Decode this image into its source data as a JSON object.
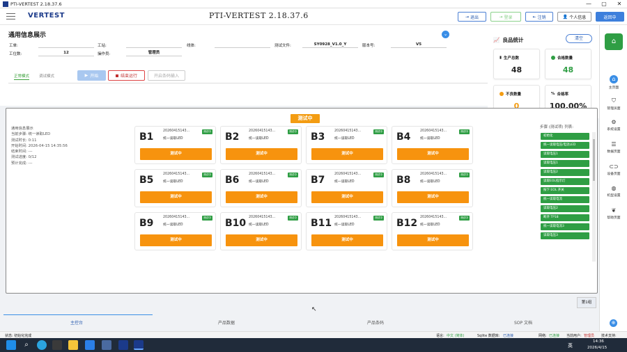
{
  "window": {
    "title": "PTI-VERTEST 2.18.37.6",
    "controls": [
      "—",
      "▢",
      "✕"
    ]
  },
  "header": {
    "logo": "VERTEST",
    "title": "PTI-VERTEST  2.18.37.6",
    "buttons": {
      "exit": "退出",
      "login": "登录",
      "logout": "注销",
      "profile": "个人信息",
      "back": "返回中"
    }
  },
  "page": {
    "title": "通用信息展示"
  },
  "form": {
    "row1": [
      {
        "label": "工单:",
        "value": ""
      },
      {
        "label": "工站:",
        "value": ""
      },
      {
        "label": "线体:",
        "value": ""
      },
      {
        "label": "测试文件:",
        "value": "SY0928_V1.0_Y"
      },
      {
        "label": "版本号:",
        "value": "V5"
      }
    ],
    "row2": [
      {
        "label": "工位数:",
        "value": "12"
      },
      {
        "label": "操作员:",
        "value": "管理员"
      }
    ]
  },
  "modes": {
    "normal": "正常模式",
    "debug": "调试模式"
  },
  "controls": {
    "start": "开始",
    "stop": "结束运行",
    "scan": "开启条码输入"
  },
  "stats": {
    "title": "良品统计",
    "clear": "清空",
    "cards": [
      {
        "label": "生产总数",
        "value": "48",
        "color": "#222222"
      },
      {
        "label": "合格数量",
        "value": "48",
        "color": "#2f9e44"
      },
      {
        "label": "不良数量",
        "value": "0",
        "color": "#f39c12"
      },
      {
        "label": "合格率",
        "value": "100.00%",
        "color": "#222222"
      }
    ]
  },
  "test": {
    "status": "测试中",
    "info": [
      "通用信息展示",
      "当前步骤:  统一读取LED",
      "测试时长:  0:11",
      "开始时间:  2026-04-15 14:35:56",
      "结束时间:  ---",
      "测试进度:  0/12",
      "预计完成:  ---"
    ],
    "units": [
      {
        "name": "B1",
        "sn": "20260415143...",
        "step": "统一读取LED",
        "badge": "测试中",
        "state": "测试中"
      },
      {
        "name": "B2",
        "sn": "20260415143...",
        "step": "统一读取LED",
        "badge": "测试中",
        "state": "测试中"
      },
      {
        "name": "B3",
        "sn": "20260415143...",
        "step": "统一读取LED",
        "badge": "测试中",
        "state": "测试中"
      },
      {
        "name": "B4",
        "sn": "20260415143...",
        "step": "统一读取LED",
        "badge": "测试中",
        "state": "测试中"
      },
      {
        "name": "B5",
        "sn": "20260415143...",
        "step": "统一读取LED",
        "badge": "测试中",
        "state": "测试中"
      },
      {
        "name": "B6",
        "sn": "20260415143...",
        "step": "统一读取LED",
        "badge": "测试中",
        "state": "测试中"
      },
      {
        "name": "B7",
        "sn": "20260415143...",
        "step": "统一读取LED",
        "badge": "测试中",
        "state": "测试中"
      },
      {
        "name": "B8",
        "sn": "20260415143...",
        "step": "统一读取LED",
        "badge": "测试中",
        "state": "测试中"
      },
      {
        "name": "B9",
        "sn": "20260415143...",
        "step": "统一读取LED",
        "badge": "测试中",
        "state": "测试中"
      },
      {
        "name": "B10",
        "sn": "20260415143...",
        "step": "统一读取LED",
        "badge": "测试中",
        "state": "测试中"
      },
      {
        "name": "B11",
        "sn": "20260415143...",
        "step": "统一读取LED",
        "badge": "测试中",
        "state": "测试中"
      },
      {
        "name": "B12",
        "sn": "20260415143...",
        "step": "统一读取LED",
        "badge": "测试中",
        "state": "测试中"
      }
    ],
    "steps_title": "步骤 (测试项) 列表:",
    "steps": [
      "初始化",
      "统一读取电压/电流LED",
      "读取电压1",
      "读取电压1",
      "读取电压2",
      "读取EOL指示灯",
      "按下 EOL 开关",
      "统一读取电流",
      "读取电压2",
      "断开 TP18",
      "统一读取电流3",
      "读取电压3"
    ],
    "group": "第1组"
  },
  "bottom_tabs": [
    "主控台",
    "产品数据",
    "产品条码",
    "SOP 文档"
  ],
  "status_bar": {
    "left": "状态:  初始化完成",
    "lang_label": "语言:",
    "lang": "中文 (简体)",
    "db_label": "Sqlite 数据库:",
    "db": "已连接",
    "net_label": "网络:",
    "net": "已连接",
    "user_label": "当前用户:",
    "user": "管理员",
    "support": "技术支持:"
  },
  "right_nav": [
    "主页面",
    "管理员面",
    "系统设置",
    "数据页面",
    "设备页面",
    "机型设置",
    "帮助页面"
  ],
  "taskbar": {
    "time": "14:36",
    "date": "2026/4/15",
    "lang": "英"
  }
}
